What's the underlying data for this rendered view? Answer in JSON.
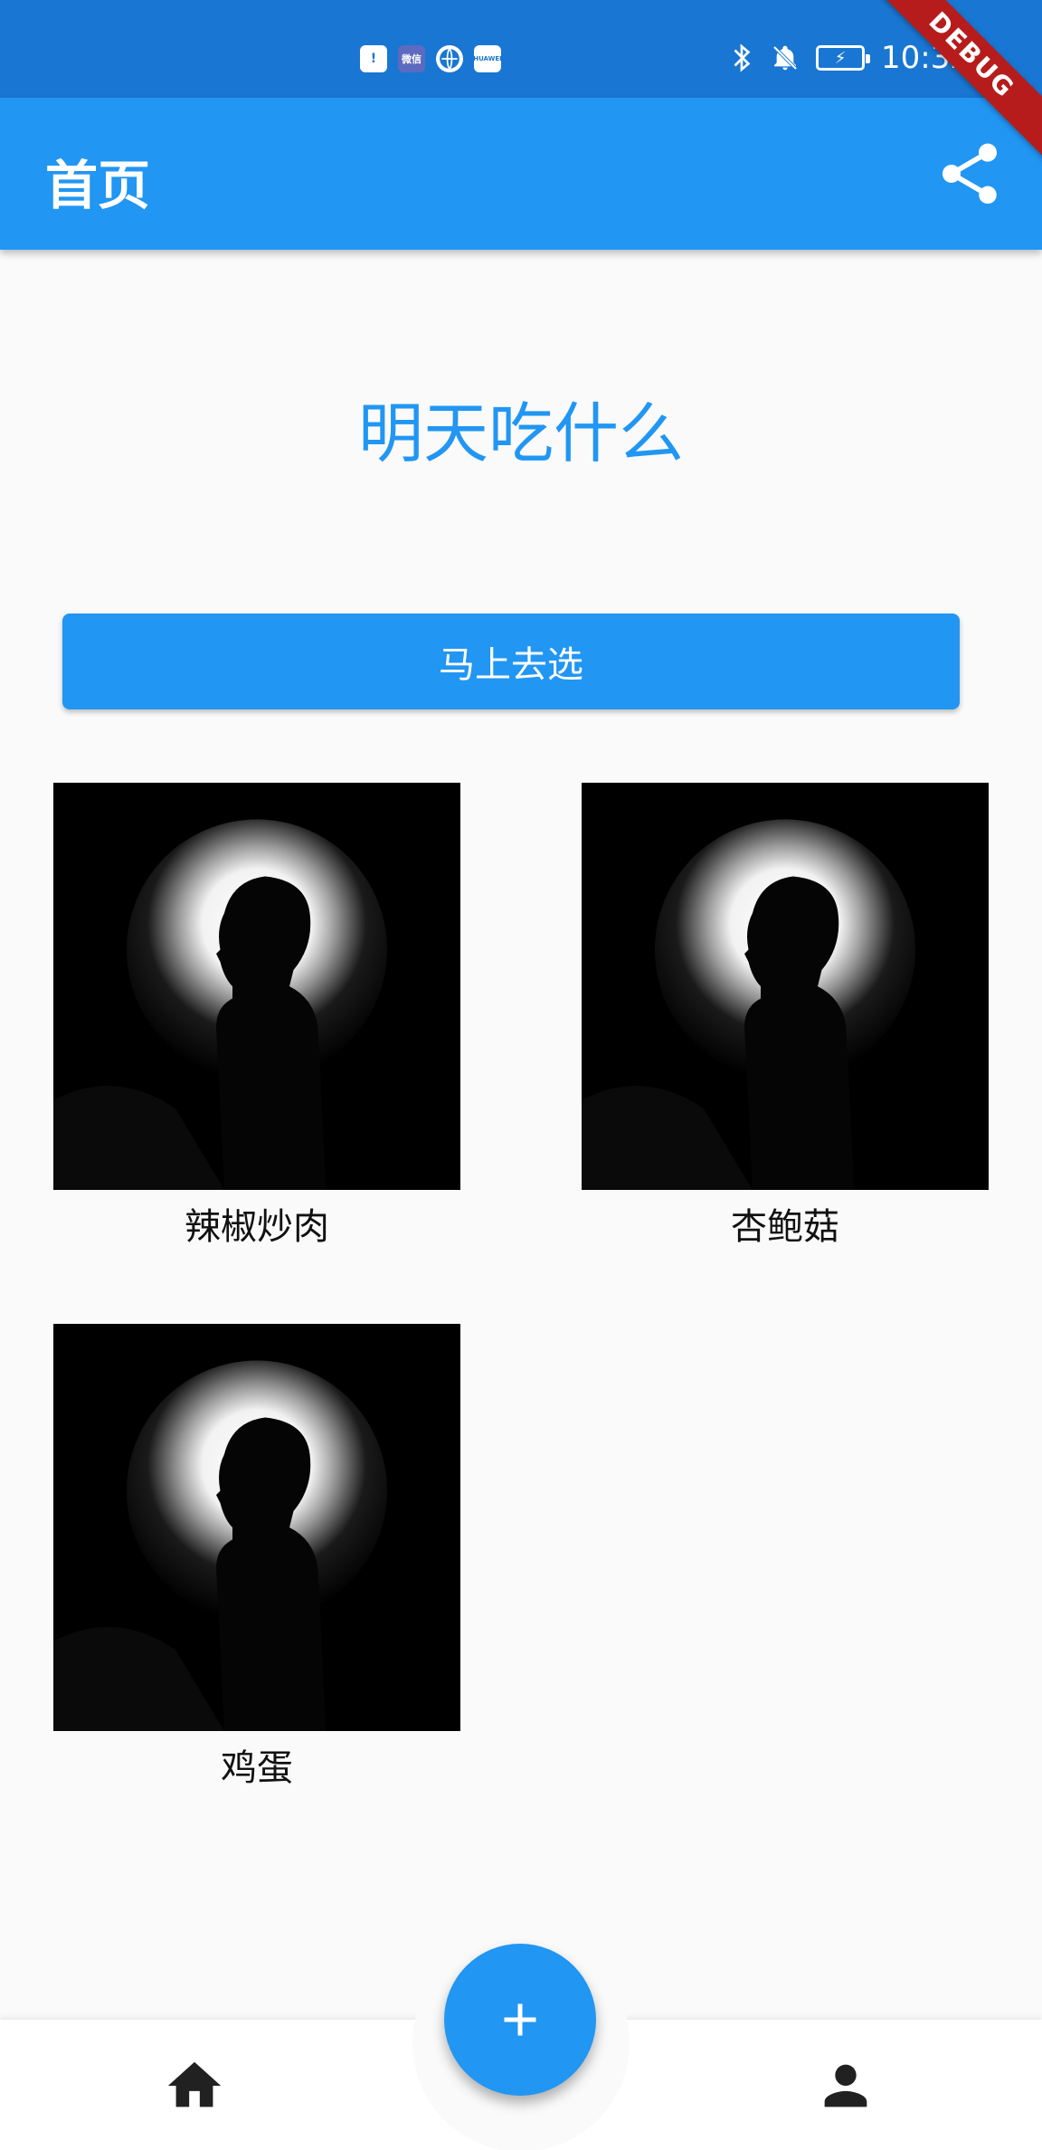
{
  "status_bar": {
    "notifications": [
      "!",
      "微信",
      "",
      "HUAWEI"
    ],
    "time": "10:32",
    "debug_banner": "DEBUG"
  },
  "app_bar": {
    "title": "首页",
    "share_icon": "share-icon"
  },
  "main": {
    "headline": "明天吃什么",
    "pick_button_label": "马上去选",
    "foods": [
      {
        "label": "辣椒炒肉"
      },
      {
        "label": "杏鲍菇"
      },
      {
        "label": "鸡蛋"
      }
    ]
  },
  "bottom_nav": {
    "home_icon": "home-icon",
    "profile_icon": "person-icon",
    "fab_icon": "plus-icon"
  },
  "colors": {
    "status_bar": "#1976d2",
    "primary": "#2196f3",
    "debug": "#b71c1c"
  }
}
